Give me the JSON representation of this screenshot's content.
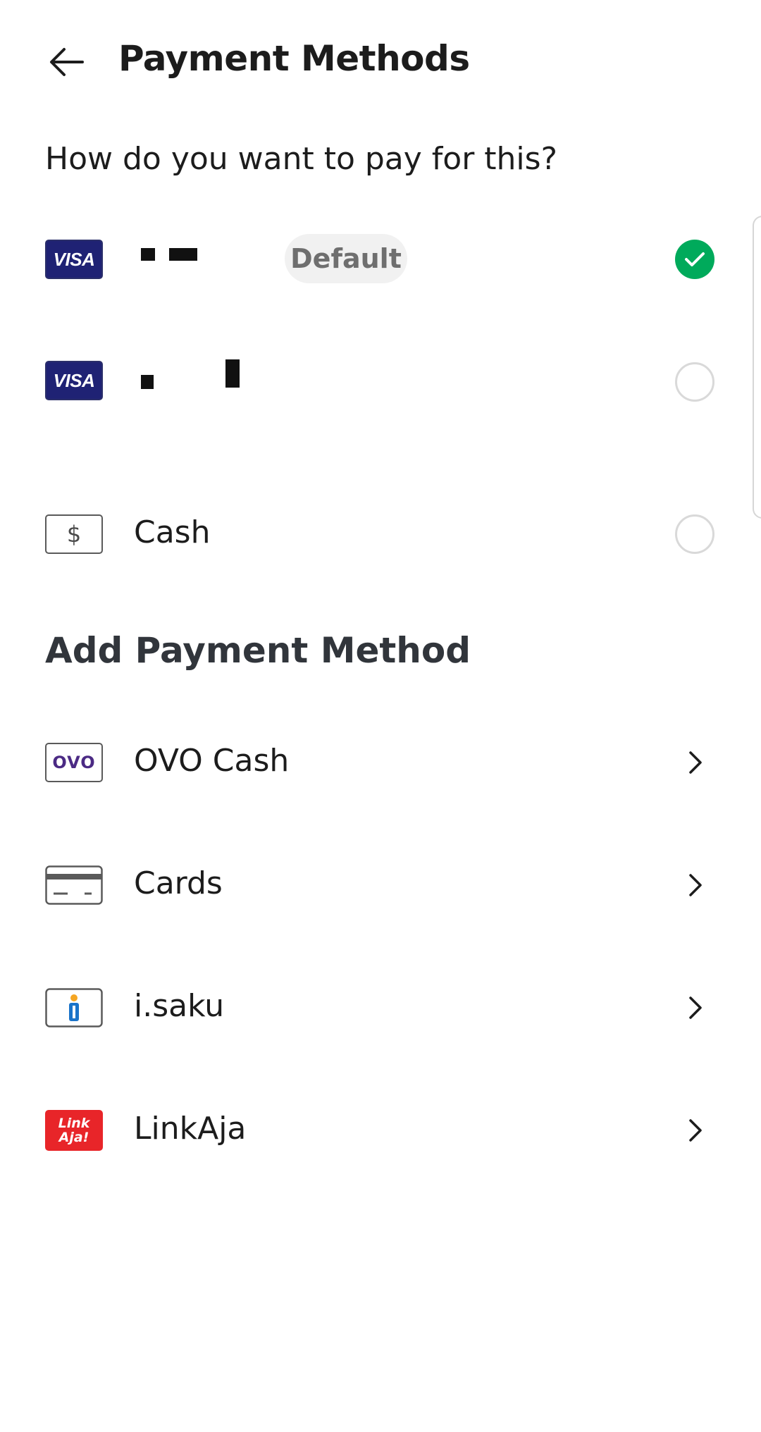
{
  "header": {
    "title": "Payment Methods",
    "back_icon": "arrow-left-icon"
  },
  "prompt": "How do you want to pay for this?",
  "saved_methods": [
    {
      "brand": "VISA",
      "badge": "Default",
      "selected": true
    },
    {
      "brand": "VISA",
      "selected": false
    },
    {
      "label": "Cash",
      "icon": "dollar-icon",
      "icon_glyph": "$",
      "selected": false
    }
  ],
  "add_section": {
    "title": "Add Payment Method",
    "items": [
      {
        "label": "OVO Cash",
        "icon": "ovo-logo-icon",
        "logo_text": "OVO"
      },
      {
        "label": "Cards",
        "icon": "card-icon"
      },
      {
        "label": "i.saku",
        "icon": "isaku-logo-icon"
      },
      {
        "label": "LinkAja",
        "icon": "linkaja-logo-icon",
        "logo_line1": "Link",
        "logo_line2": "Aja!"
      }
    ]
  },
  "colors": {
    "accent_green": "#00aa5b",
    "visa_blue": "#1f2274",
    "linkaja_red": "#e82529",
    "ovo_purple": "#4b2a84",
    "isaku_blue": "#1a73c9",
    "isaku_orange": "#f5a623"
  }
}
